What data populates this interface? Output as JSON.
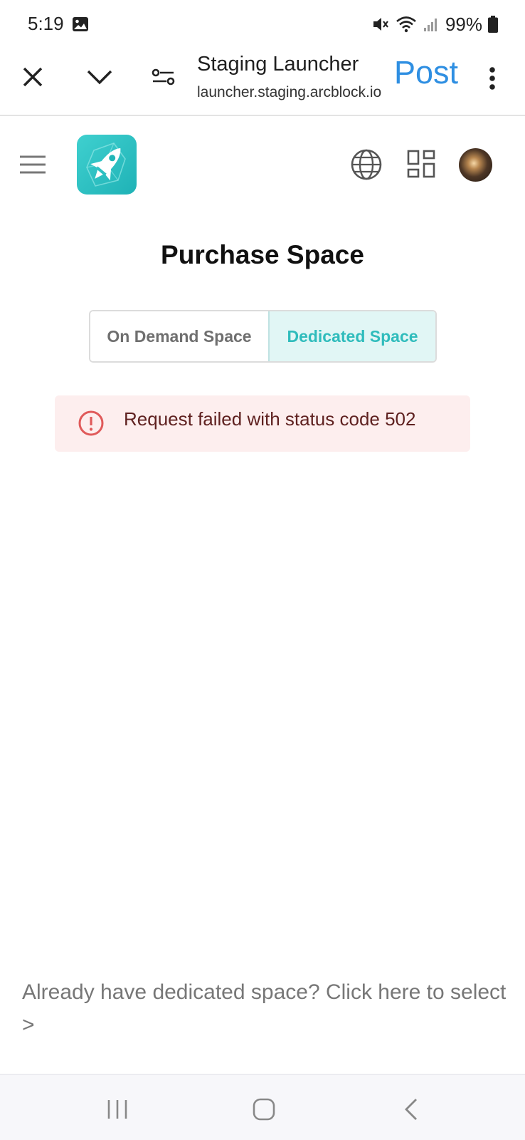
{
  "status_bar": {
    "time": "5:19",
    "battery": "99%",
    "icons": [
      "gallery-icon",
      "mute-icon",
      "wifi-icon",
      "signal-icon",
      "battery-icon"
    ]
  },
  "browser": {
    "title": "Staging Launcher",
    "url": "launcher.staging.arcblock.io",
    "post_label": "Post",
    "icons": [
      "close-icon",
      "chevron-down-icon",
      "tune-icon",
      "more-vert-icon"
    ],
    "accent_color": "#2f8fe2"
  },
  "header": {
    "icons": [
      "menu-icon",
      "rocket-logo",
      "globe-icon",
      "apps-grid-icon",
      "avatar"
    ]
  },
  "main": {
    "title": "Purchase Space",
    "tabs": [
      {
        "label": "On Demand Space",
        "active": false
      },
      {
        "label": "Dedicated Space",
        "active": true
      }
    ],
    "active_color": "#2fbcbc",
    "error": {
      "message": "Request failed with status code 502",
      "icon": "error-circle-icon",
      "color": "#d32f2f"
    },
    "footer_link": "Already have dedicated space? Click here to select >"
  },
  "nav_bar": {
    "icons": [
      "recents-icon",
      "home-icon",
      "back-icon"
    ]
  }
}
